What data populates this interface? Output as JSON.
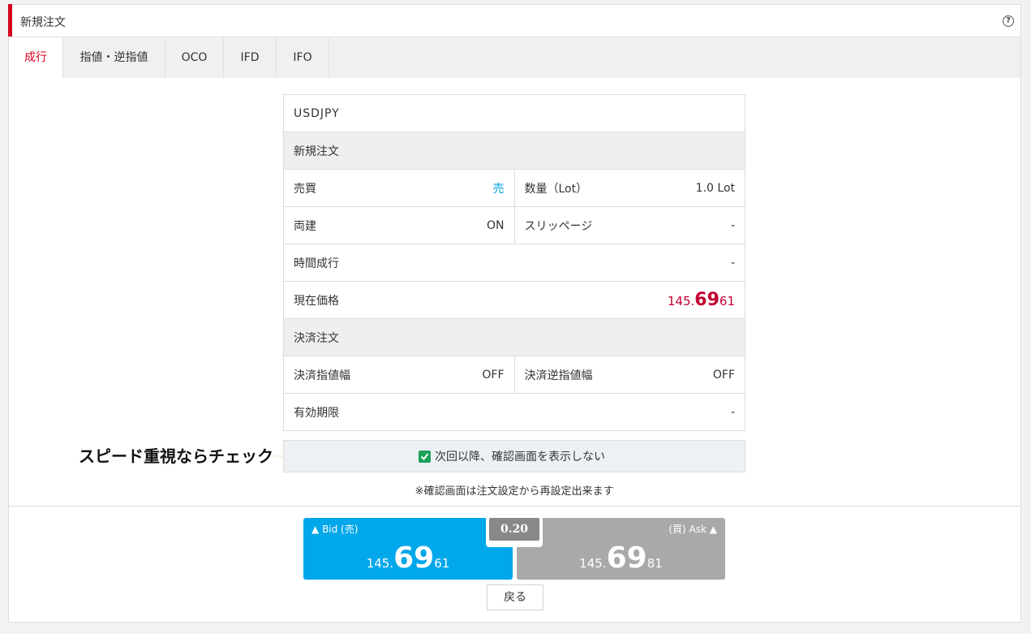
{
  "header": {
    "title": "新規注文",
    "help_icon": "?"
  },
  "tabs": [
    "成行",
    "指値・逆指値",
    "OCO",
    "IFD",
    "IFO"
  ],
  "summary": {
    "pair": "USDJPY",
    "section_new": "新規注文",
    "side_label": "売買",
    "side_value": "売",
    "qty_label": "数量（Lot）",
    "qty_value": "1.0 Lot",
    "hedge_label": "両建",
    "hedge_value": "ON",
    "slippage_label": "スリッページ",
    "slippage_value": "-",
    "time_label": "時間成行",
    "time_value": "-",
    "current_label": "現在価格",
    "current_price": {
      "prefix": "145.",
      "main": "69",
      "suffix": "61"
    },
    "section_settle": "決済注文",
    "limit_label": "決済指値幅",
    "limit_value": "OFF",
    "stop_label": "決済逆指値幅",
    "stop_value": "OFF",
    "expiry_label": "有効期限",
    "expiry_value": "-"
  },
  "confirm": {
    "checkbox_label": "次回以降、確認画面を表示しない",
    "checked": true
  },
  "note": "※確認画面は注文設定から再設定出来ます",
  "annotation": "スピード重視ならチェック",
  "quote": {
    "bid_label": "Bid (売)",
    "bid": {
      "prefix": "145.",
      "main": "69",
      "suffix": "61"
    },
    "ask_label": "(買) Ask",
    "ask": {
      "prefix": "145.",
      "main": "69",
      "suffix": "81"
    },
    "spread": "0.20"
  },
  "back_button": "戻る",
  "colors": {
    "accent": "#d6001c",
    "bid": "#00a7ea",
    "ask": "#a9a9a9",
    "check": "#1aa35a",
    "arrow": "#8cc63f"
  }
}
